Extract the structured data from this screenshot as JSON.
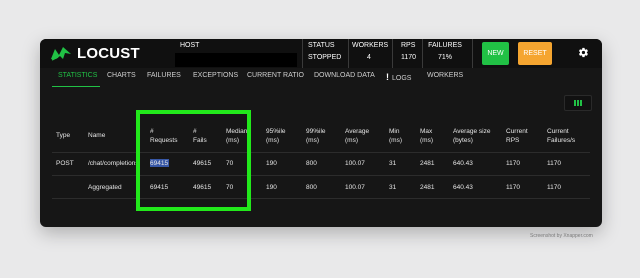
{
  "app": {
    "logo_text": "LOCUST",
    "host_label": "HOST",
    "status_label": "STATUS",
    "status_value": "STOPPED",
    "workers_label": "WORKERS",
    "workers_value": "4",
    "rps_label": "RPS",
    "rps_value": "1170",
    "failures_label": "FAILURES",
    "failures_value": "71%",
    "new_button": "NEW",
    "reset_button": "RESET",
    "accent_color": "#21c145",
    "reset_color": "#f5a530",
    "highlight_color": "#22e81b"
  },
  "tabs": [
    {
      "label": "STATISTICS"
    },
    {
      "label": "CHARTS"
    },
    {
      "label": "FAILURES"
    },
    {
      "label": "EXCEPTIONS"
    },
    {
      "label": "CURRENT RATIO"
    },
    {
      "label": "DOWNLOAD DATA"
    },
    {
      "label": "LOGS"
    },
    {
      "label": "WORKERS"
    }
  ],
  "table": {
    "headers": [
      [
        "Type"
      ],
      [
        "Name"
      ],
      [
        "#",
        "Requests"
      ],
      [
        "#",
        "Fails"
      ],
      [
        "Median",
        "(ms)"
      ],
      [
        "95%ile",
        "(ms)"
      ],
      [
        "99%ile",
        "(ms)"
      ],
      [
        "Average",
        "(ms)"
      ],
      [
        "Min",
        "(ms)"
      ],
      [
        "Max",
        "(ms)"
      ],
      [
        "Average size",
        "(bytes)"
      ],
      [
        "Current",
        "RPS"
      ],
      [
        "Current",
        "Failures/s"
      ]
    ],
    "rows": [
      [
        "POST",
        "/chat/completions",
        "69415",
        "49615",
        "70",
        "190",
        "800",
        "100.07",
        "31",
        "2481",
        "640.43",
        "1170",
        "1170"
      ],
      [
        "",
        "Aggregated",
        "69415",
        "49615",
        "70",
        "190",
        "800",
        "100.07",
        "31",
        "2481",
        "640.43",
        "1170",
        "1170"
      ]
    ]
  },
  "watermark": "Screenshot by Xnapper.com"
}
